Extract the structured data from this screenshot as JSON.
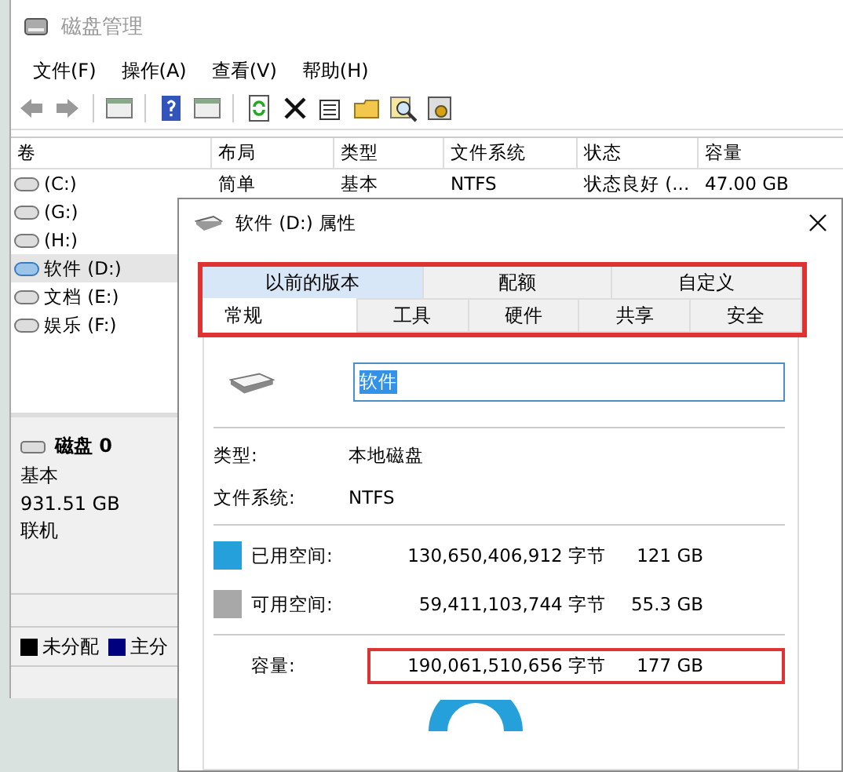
{
  "window": {
    "title": "磁盘管理"
  },
  "menu": [
    "文件(F)",
    "操作(A)",
    "查看(V)",
    "帮助(H)"
  ],
  "volume_table": {
    "columns": [
      "卷",
      "布局",
      "类型",
      "文件系统",
      "状态",
      "容量"
    ],
    "rows": [
      {
        "cells": [
          "(C:)",
          "简单",
          "基本",
          "NTFS",
          "状态良好 (...",
          "47.00 GB"
        ],
        "selected": false
      },
      {
        "cells": [
          "(G:)"
        ],
        "selected": false
      },
      {
        "cells": [
          "(H:)"
        ],
        "selected": false
      },
      {
        "cells": [
          "软件 (D:)"
        ],
        "selected": true
      },
      {
        "cells": [
          "文档 (E:)"
        ],
        "selected": false
      },
      {
        "cells": [
          "娱乐 (F:)"
        ],
        "selected": false
      }
    ]
  },
  "disk": {
    "name": "磁盘 0",
    "type": "基本",
    "size": "931.51 GB",
    "status": "联机"
  },
  "legend": [
    {
      "label": "未分配",
      "color": "#000000"
    },
    {
      "label": "主分",
      "color": "#00007f"
    }
  ],
  "dialog": {
    "title": "软件 (D:) 属性",
    "tabs_highlighted": true,
    "tab_rows": [
      [
        {
          "label": "以前的版本",
          "selected": false,
          "hovered": true
        },
        {
          "label": "配额",
          "selected": false,
          "hovered": false
        },
        {
          "label": "自定义",
          "selected": false,
          "hovered": false
        }
      ],
      [
        {
          "label": "常规",
          "selected": true,
          "hovered": false
        },
        {
          "label": "工具",
          "selected": false,
          "hovered": false
        },
        {
          "label": "硬件",
          "selected": false,
          "hovered": false
        },
        {
          "label": "共享",
          "selected": false,
          "hovered": false
        },
        {
          "label": "安全",
          "selected": false,
          "hovered": false
        }
      ]
    ],
    "name_value": "软件",
    "info": [
      {
        "label": "类型:",
        "value": "本地磁盘"
      },
      {
        "label": "文件系统:",
        "value": "NTFS"
      }
    ],
    "space": [
      {
        "label": "已用空间:",
        "bytes": "130,650,406,912 字节",
        "size": "121 GB",
        "color": "#26a0da"
      },
      {
        "label": "可用空间:",
        "bytes": "59,411,103,744 字节",
        "size": "55.3 GB",
        "color": "#a8a8a8"
      }
    ],
    "capacity": {
      "label": "容量:",
      "bytes": "190,061,510,656 字节",
      "size": "177 GB",
      "highlighted": true
    }
  }
}
